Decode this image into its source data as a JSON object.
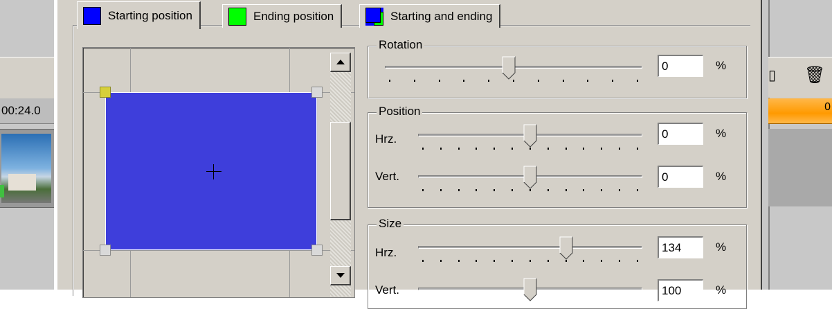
{
  "background": {
    "timecode_left": "00:24.0",
    "ruler_right": "0"
  },
  "tabs": [
    {
      "label": "Starting position",
      "color": "#0000ff",
      "active": true
    },
    {
      "label": "Ending position",
      "color": "#00ff00",
      "active": false
    },
    {
      "label": "Starting and ending",
      "color": "#0000ff",
      "color2": "#00ff00",
      "active": false
    }
  ],
  "preview": {
    "rect_color": "#3e3edb"
  },
  "rotation": {
    "title": "Rotation",
    "value": "0",
    "unit": "%",
    "slider_fraction": 0.48
  },
  "position": {
    "title": "Position",
    "hrz_label": "Hrz.",
    "hrz_value": "0",
    "hrz_fraction": 0.5,
    "vert_label": "Vert.",
    "vert_value": "0",
    "vert_fraction": 0.5,
    "unit": "%"
  },
  "size": {
    "title": "Size",
    "hrz_label": "Hrz.",
    "hrz_value": "134",
    "hrz_fraction": 0.67,
    "vert_label": "Vert.",
    "vert_value": "100",
    "vert_fraction": 0.5,
    "unit": "%"
  }
}
